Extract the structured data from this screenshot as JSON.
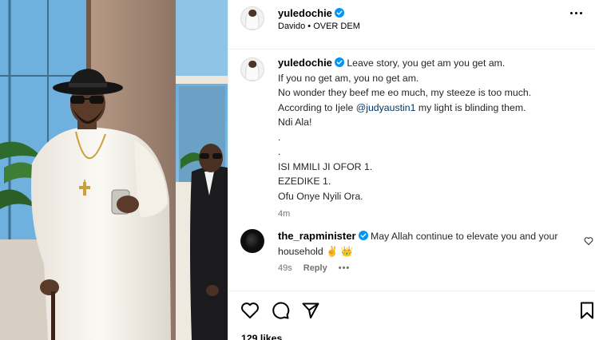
{
  "post": {
    "username": "yuledochie",
    "subtitle": "Davido • OVER DEM"
  },
  "caption": {
    "username": "yuledochie",
    "line1_rest": " Leave story, you get am you get am.",
    "line2": "If you no get am, you no get am.",
    "line3": "No wonder they beef me eo much, my steeze is too much.",
    "line4_pre": "According to Ijele ",
    "line4_mention": "@judyaustin1",
    "line4_post": " my light is blinding them.",
    "line5": "Ndi Ala!",
    "line6": ".",
    "line7": ".",
    "line8": "ISI MMILI JI OFOR 1.",
    "line9": "EZEDIKE 1.",
    "line10": "Ofu Onye Nyili Ora.",
    "time": "4m"
  },
  "comment": {
    "username": "the_rapminister",
    "text": " May Allah continue to elevate you and your household ✌️ 👑",
    "time": "49s",
    "reply_label": "Reply",
    "more_label": "•••"
  },
  "actions": {
    "likes": "129 likes"
  },
  "icons": {
    "verified": "verified-badge-icon",
    "more": "more-options-icon",
    "like": "heart-icon",
    "comment": "comment-icon",
    "share": "share-icon",
    "save": "bookmark-icon",
    "comment_like": "heart-outline-icon"
  },
  "colors": {
    "verified": "#0095f6",
    "mention": "#00376b",
    "muted": "#737373",
    "divider": "#efefef"
  }
}
